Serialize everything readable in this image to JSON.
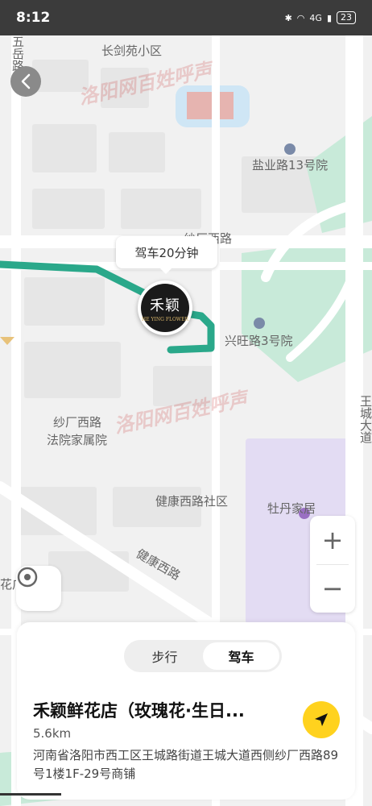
{
  "status_bar": {
    "time": "8:12",
    "network": "4G",
    "battery": "23"
  },
  "map": {
    "labels": {
      "changjianyuan": "长剑苑小区",
      "wuyue": "五岳路",
      "yanye13": "盐业路13号院",
      "shachangxi_top": "纱厂西路",
      "xingwang3": "兴旺路3号院",
      "shachangxi": "纱厂西路",
      "fayuan": "法院家属院",
      "jiankangxi_shequ": "健康西路社区",
      "jiankangxi": "健康西路",
      "mudan": "牡丹家居",
      "wangcheng": "王城大道",
      "left_edge": "花广"
    },
    "watermark": "洛阳网百姓呼声",
    "drive_time": "驾车20分钟",
    "shop_logo_chars": "禾颖",
    "shop_logo_sub": "HE YING FLOWER",
    "route_color": "#2aa88a"
  },
  "controls": {
    "zoom_in": "+",
    "zoom_out": "−"
  },
  "card": {
    "modes": [
      "步行",
      "驾车"
    ],
    "active_mode": "驾车",
    "shop_name": "禾颖鲜花店（玫瑰花·生日...",
    "distance": "5.6km",
    "address": "河南省洛阳市西工区王城路街道王城大道西侧纱厂西路89号1楼1F-29号商铺"
  }
}
